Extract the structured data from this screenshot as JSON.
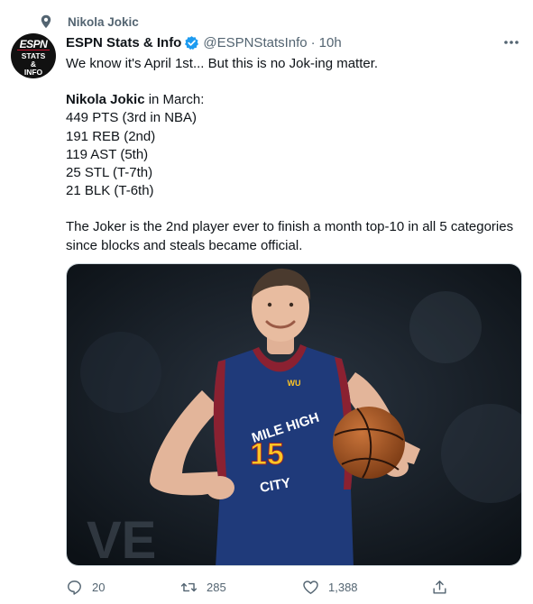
{
  "context": {
    "label": "Nikola Jokic",
    "icon": "location-pin-icon"
  },
  "author": {
    "name": "ESPN Stats & Info",
    "handle": "@ESPNStatsInfo",
    "separator": "·",
    "time": "10h",
    "avatar": {
      "brand": "ESPN",
      "line1": "STATS",
      "line2": "&",
      "line3": "INFO"
    },
    "verified": true
  },
  "tweet": {
    "intro": "We know it's April 1st... But this is no Jok-ing matter.",
    "stats_subject": "Nikola Jokic",
    "stats_heading_rest": " in March:",
    "stats": [
      "449 PTS (3rd in NBA)",
      "191 REB (2nd)",
      "119 AST (5th)",
      "25 STL (T-7th)",
      "21 BLK (T-6th)"
    ],
    "closing": "The Joker is the 2nd player ever to finish a month top-10 in all 5 categories since blocks and steals became official."
  },
  "media": {
    "jersey_line1": "MILE HIGH",
    "jersey_number": "15",
    "jersey_line2": "CITY",
    "sponsor": "WU",
    "background_text": "VE"
  },
  "actions": {
    "replies": "20",
    "retweets": "285",
    "likes": "1,388"
  },
  "colors": {
    "text": "#0f1419",
    "secondary": "#536471",
    "verified": "#1d9bf0",
    "jersey_navy": "#1f3a7a",
    "jersey_gold": "#fec524",
    "jersey_red": "#8b2131"
  }
}
